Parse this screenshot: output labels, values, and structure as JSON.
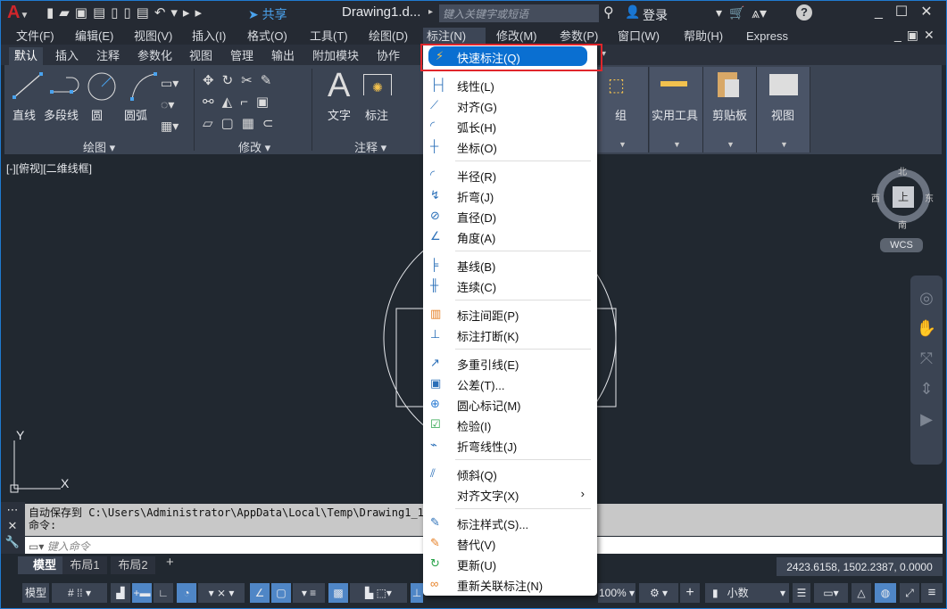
{
  "titlebar": {
    "title": "Drawing1.d...",
    "share": "共享",
    "search_placeholder": "键入关键字或短语",
    "login": "登录"
  },
  "menubar": [
    "文件(F)",
    "编辑(E)",
    "视图(V)",
    "插入(I)",
    "格式(O)",
    "工具(T)",
    "绘图(D)",
    "标注(N)",
    "修改(M)",
    "参数(P)",
    "窗口(W)",
    "帮助(H)",
    "Express"
  ],
  "ribbon_tabs": [
    "默认",
    "插入",
    "注释",
    "参数化",
    "视图",
    "管理",
    "输出",
    "附加模块",
    "协作"
  ],
  "ribbon": {
    "draw": {
      "label": "绘图",
      "buttons": [
        "直线",
        "多段线",
        "圆",
        "圆弧"
      ]
    },
    "modify": {
      "label": "修改"
    },
    "annotation": {
      "label": "注释",
      "buttons": [
        "文字",
        "标注"
      ]
    },
    "panels": [
      "组",
      "实用工具",
      "剪贴板",
      "视图"
    ]
  },
  "viewport": {
    "label": "[-][俯视][二维线框]",
    "compass": {
      "n": "北",
      "s": "南",
      "e": "东",
      "w": "西",
      "top": "上"
    },
    "wcs": "WCS",
    "ucs_x": "X",
    "ucs_y": "Y"
  },
  "dimension_menu": {
    "groups": [
      [
        {
          "label": "快速标注(Q)",
          "icon": "quick-dimension-icon",
          "highlighted": true
        }
      ],
      [
        {
          "label": "线性(L)",
          "icon": "linear-icon"
        },
        {
          "label": "对齐(G)",
          "icon": "aligned-icon"
        },
        {
          "label": "弧长(H)",
          "icon": "arc-length-icon"
        },
        {
          "label": "坐标(O)",
          "icon": "ordinate-icon"
        }
      ],
      [
        {
          "label": "半径(R)",
          "icon": "radius-icon"
        },
        {
          "label": "折弯(J)",
          "icon": "jogged-icon"
        },
        {
          "label": "直径(D)",
          "icon": "diameter-icon"
        },
        {
          "label": "角度(A)",
          "icon": "angular-icon"
        }
      ],
      [
        {
          "label": "基线(B)",
          "icon": "baseline-icon"
        },
        {
          "label": "连续(C)",
          "icon": "continue-icon"
        }
      ],
      [
        {
          "label": "标注间距(P)",
          "icon": "dim-space-icon"
        },
        {
          "label": "标注打断(K)",
          "icon": "dim-break-icon"
        }
      ],
      [
        {
          "label": "多重引线(E)",
          "icon": "multileader-icon"
        },
        {
          "label": "公差(T)...",
          "icon": "tolerance-icon"
        },
        {
          "label": "圆心标记(M)",
          "icon": "center-mark-icon"
        },
        {
          "label": "检验(I)",
          "icon": "inspection-icon"
        },
        {
          "label": "折弯线性(J)",
          "icon": "jogged-linear-icon"
        }
      ],
      [
        {
          "label": "倾斜(Q)",
          "icon": "oblique-icon"
        },
        {
          "label": "对齐文字(X)",
          "icon": "",
          "submenu": true
        }
      ],
      [
        {
          "label": "标注样式(S)...",
          "icon": "dim-style-icon"
        },
        {
          "label": "替代(V)",
          "icon": "override-icon"
        },
        {
          "label": "更新(U)",
          "icon": "update-icon"
        },
        {
          "label": "重新关联标注(N)",
          "icon": "reassociate-icon"
        }
      ]
    ]
  },
  "command": {
    "history": [
      "自动保存到 C:\\Users\\Administrator\\AppData\\Local\\Temp\\Drawing1_1_",
      "命令:"
    ],
    "placeholder": "键入命令"
  },
  "layout_tabs": [
    "模型",
    "布局1",
    "布局2"
  ],
  "status": {
    "model": "模型",
    "coords": "2423.6158, 1502.2387, 0.0000",
    "zoom": "100%",
    "units": "小数"
  }
}
